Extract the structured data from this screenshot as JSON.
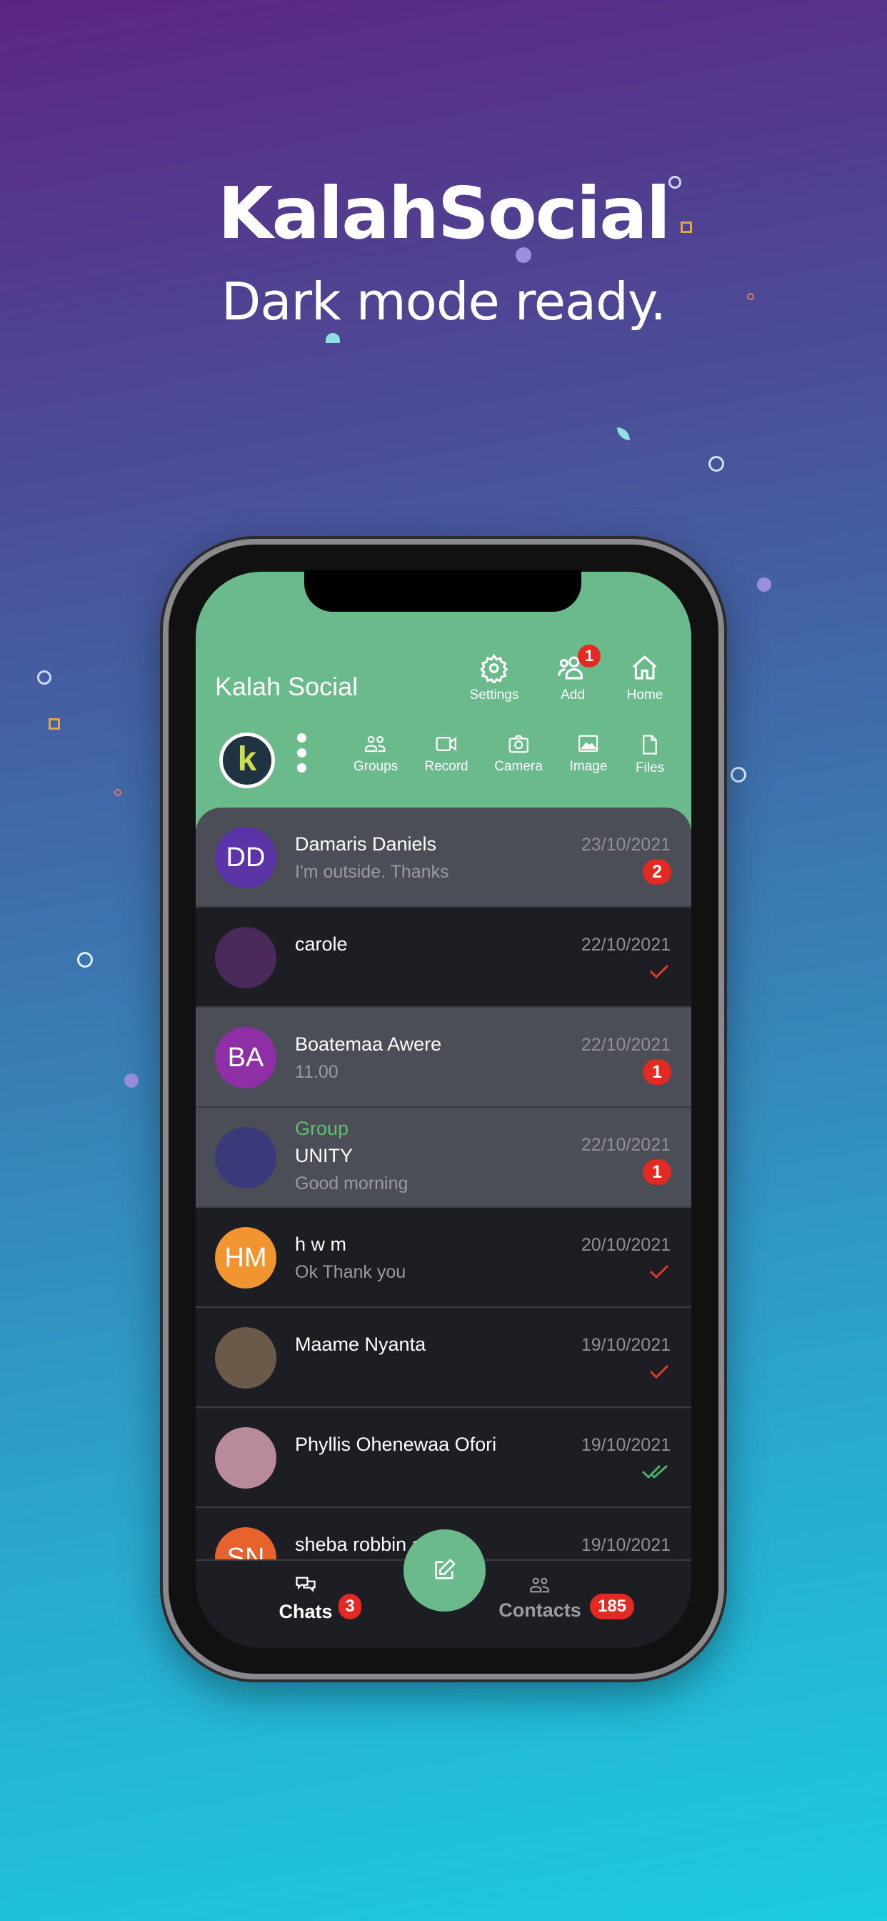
{
  "promo": {
    "title": "KalahSocial",
    "subtitle": "Dark mode ready."
  },
  "app": {
    "title": "Kalah Social",
    "accent": "#6aba8c",
    "top_actions": [
      {
        "label": "Settings",
        "icon": "gear-icon"
      },
      {
        "label": "Add",
        "icon": "add-people-icon",
        "badge": "1"
      },
      {
        "label": "Home",
        "icon": "home-icon"
      }
    ],
    "tools": [
      {
        "label": "Groups",
        "icon": "groups-icon"
      },
      {
        "label": "Record",
        "icon": "video-icon"
      },
      {
        "label": "Camera",
        "icon": "camera-icon"
      },
      {
        "label": "Image",
        "icon": "image-icon"
      },
      {
        "label": "Files",
        "icon": "file-icon"
      }
    ],
    "chats": [
      {
        "initials": "DD",
        "color": "#5b35a8",
        "name": "Damaris Daniels",
        "message": " I'm outside.  Thanks",
        "date": "23/10/2021",
        "unread": "2"
      },
      {
        "photo": true,
        "color": "#4a2a5a",
        "name": "carole",
        "message": "",
        "date": "22/10/2021",
        "status": "sent"
      },
      {
        "initials": "BA",
        "color": "#8e2fa6",
        "name": "Boatemaa Awere",
        "message": "11.00",
        "date": "22/10/2021",
        "unread": "1"
      },
      {
        "photo": true,
        "color": "#3a3a7a",
        "group_label": "Group",
        "name": "UNITY",
        "message": "Good morning",
        "date": "22/10/2021",
        "unread": "1"
      },
      {
        "initials": "HM",
        "color": "#f0952f",
        "name": "h w m",
        "message": "Ok Thank you",
        "date": "20/10/2021",
        "status": "sent"
      },
      {
        "photo": true,
        "color": "#6b5a4a",
        "name": "Maame Nyanta",
        "message": "",
        "date": "19/10/2021",
        "status": "sent"
      },
      {
        "photo": true,
        "color": "#b88a9a",
        "name": "Phyllis Ohenewaa Ofori",
        "message": "",
        "date": "19/10/2021",
        "status": "read"
      },
      {
        "initials": "SN",
        "color": "#e8622e",
        "name": "sheba robbin   a",
        "message": "",
        "date": "19/10/2021"
      }
    ],
    "nav": {
      "chats": "Chats",
      "chats_badge": "3",
      "contacts": "Contacts",
      "contacts_badge": "185"
    }
  }
}
